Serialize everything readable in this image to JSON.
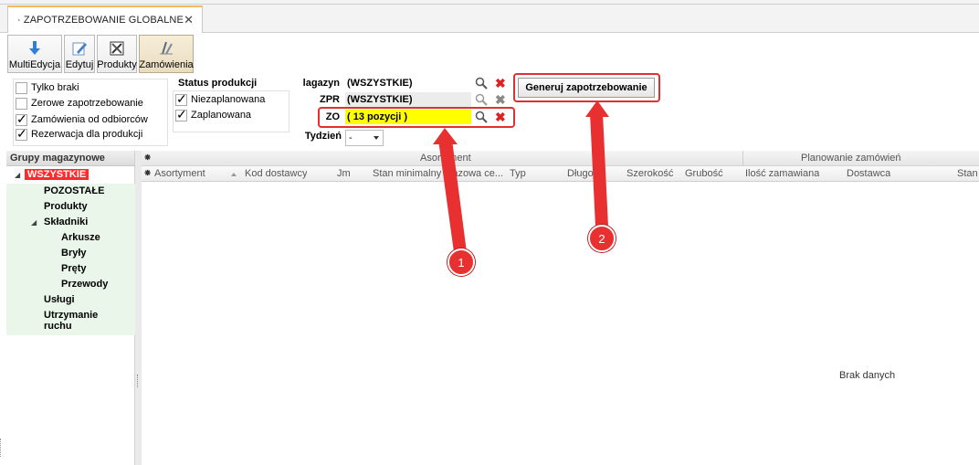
{
  "tab": {
    "title": "· ZAPOTRZEBOWANIE GLOBALNE ·",
    "close": "✕"
  },
  "toolbar": {
    "buttons": [
      {
        "label": "MultiEdycja",
        "icon": "down-arrow-icon"
      },
      {
        "label": "Edytuj",
        "icon": "pencil-icon"
      },
      {
        "label": "Produkty",
        "icon": "tools-icon"
      },
      {
        "label": "Zamówienia",
        "icon": "pencils-icon"
      }
    ]
  },
  "filters": {
    "checkboxes": [
      {
        "label": "Tylko braki",
        "checked": false
      },
      {
        "label": "Zerowe zapotrzebowanie",
        "checked": false
      },
      {
        "label": "Zamówienia od odbiorców",
        "checked": true
      },
      {
        "label": "Rezerwacja dla produkcji",
        "checked": true
      }
    ],
    "status": {
      "title": "Status produkcji",
      "items": [
        {
          "label": "Niezaplanowana",
          "checked": true
        },
        {
          "label": "Zaplanowana",
          "checked": true
        }
      ]
    },
    "magazyn": {
      "label": "lagazyn",
      "value": "(WSZYSTKIE)"
    },
    "zpr": {
      "label": "ZPR",
      "value": "(WSZYSTKIE)"
    },
    "zo": {
      "label": "ZO",
      "value": "( 13 pozycji )"
    },
    "tydzien": {
      "label": "Tydzień",
      "value": "-"
    },
    "generate_button": "Generuj zapotrzebowanie"
  },
  "tree": {
    "header": "Grupy magazynowe",
    "root": "WSZYSTKIE",
    "nodes": {
      "pozostale": "POZOSTAŁE",
      "produkty": "Produkty",
      "skladniki": "Składniki",
      "arkusze": "Arkusze",
      "bryly": "Bryły",
      "prety": "Pręty",
      "przewody": "Przewody",
      "uslugi": "Usługi",
      "utrzymanie1": "Utrzymanie",
      "utrzymanie2": "ruchu"
    }
  },
  "grid": {
    "bands": {
      "asortyment": "Asortyment",
      "planowanie": "Planowanie zamówień"
    },
    "columns": {
      "asortyment": "Asortyment",
      "kod_dostawcy": "Kod dostawcy",
      "jm": "Jm",
      "stan_minimalny": "Stan minimalny",
      "bazowa_cena": "Bazowa ce...",
      "typ": "Typ",
      "dlugosc": "Długość",
      "szerokosc": "Szerokość",
      "grubosc": "Grubość",
      "ilosc_zamawiana": "Ilość zamawiana",
      "dostawca": "Dostawca",
      "stan": "Stan"
    },
    "empty_text": "Brak danych"
  },
  "callouts": {
    "one": "1",
    "two": "2"
  },
  "colors": {
    "highlight": "#e03030",
    "zo_field": "#ffff00",
    "tree_root": "#ff2a2a",
    "callout": "#e83030"
  }
}
